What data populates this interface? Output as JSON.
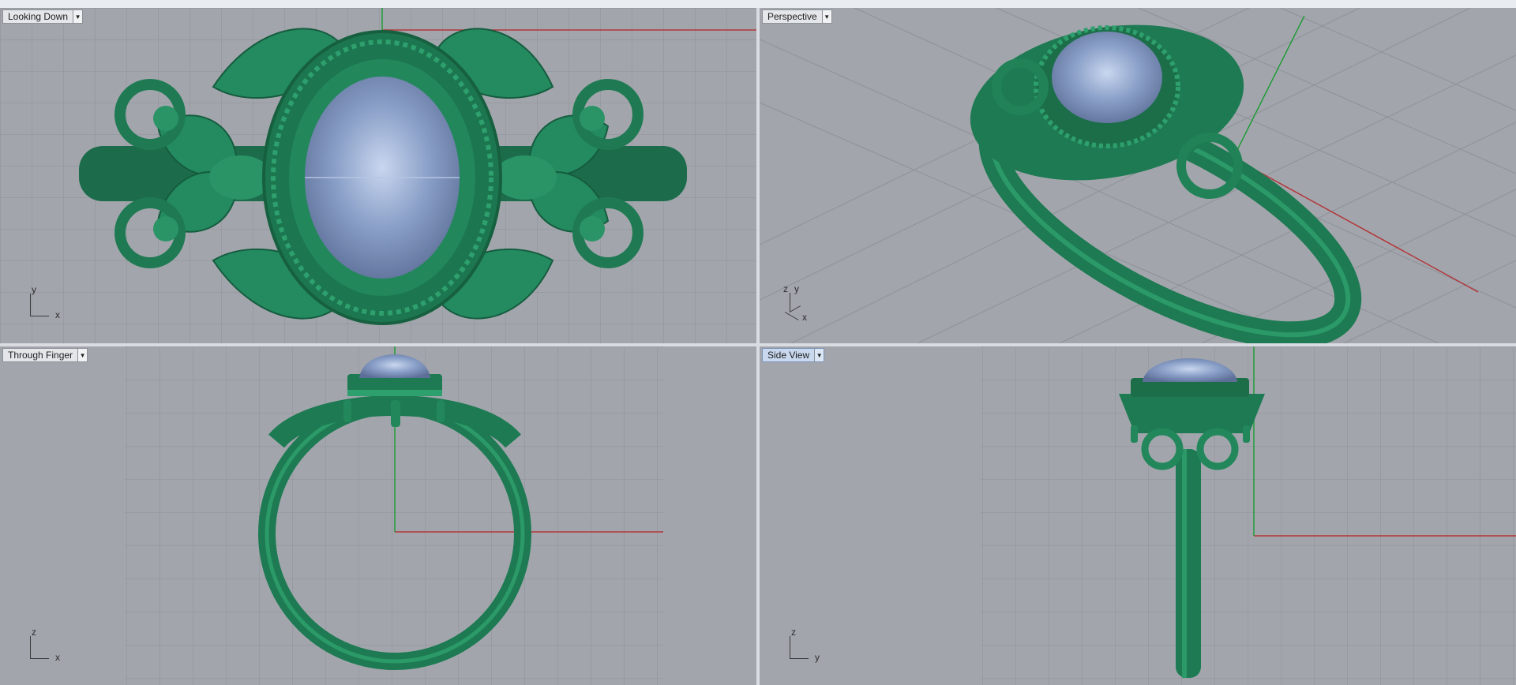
{
  "viewports": {
    "top": {
      "title": "Looking Down",
      "axis_a": "y",
      "axis_b": "x"
    },
    "perspective": {
      "title": "Perspective",
      "axis_a": "z",
      "axis_b": "y",
      "axis_c": "x"
    },
    "front": {
      "title": "Through Finger",
      "axis_a": "z",
      "axis_b": "x"
    },
    "side": {
      "title": "Side View",
      "axis_a": "z",
      "axis_b": "y"
    }
  },
  "colors": {
    "viewport_bg": "#a2a6ac",
    "grid_line": "#8e9298",
    "axis_x": "#b3363a",
    "axis_y": "#1f9b3a",
    "metal": "#21855c",
    "gem": "#7d92b8"
  },
  "icons": {
    "dropdown": "chevron-down-icon"
  }
}
